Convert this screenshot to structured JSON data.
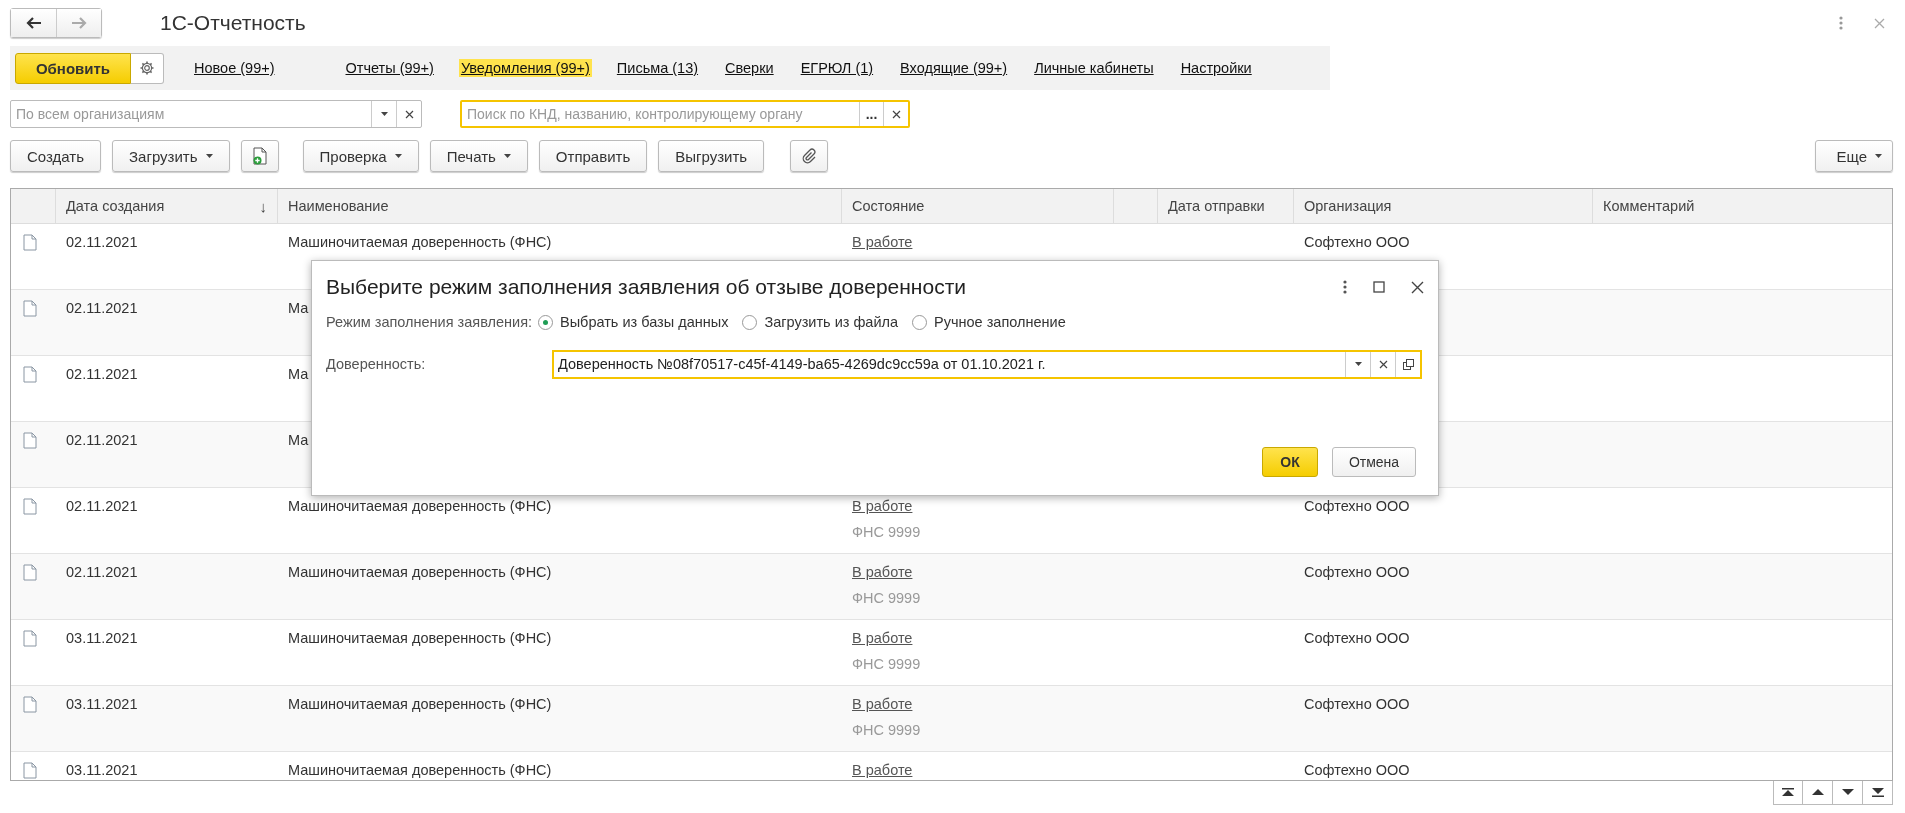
{
  "window": {
    "title": "1С-Отчетность"
  },
  "nav": {
    "refresh_button": "Обновить",
    "links": [
      {
        "label": "Новое (99+)",
        "selected": false
      },
      {
        "label": "Отчеты (99+)",
        "selected": false
      },
      {
        "label": "Уведомления (99+)",
        "selected": true
      },
      {
        "label": "Письма (13)",
        "selected": false
      },
      {
        "label": "Сверки",
        "selected": false
      },
      {
        "label": "ЕГРЮЛ (1)",
        "selected": false
      },
      {
        "label": "Входящие (99+)",
        "selected": false
      },
      {
        "label": "Личные кабинеты",
        "selected": false
      },
      {
        "label": "Настройки",
        "selected": false
      }
    ]
  },
  "filters": {
    "organization": {
      "placeholder": "По всем организациям"
    },
    "search": {
      "placeholder": "Поиск по КНД, названию, контролирующему органу",
      "more_button": "..."
    }
  },
  "toolbar": {
    "buttons": [
      {
        "label": "Создать",
        "kind": "plain"
      },
      {
        "label": "Загрузить",
        "kind": "menu"
      },
      {
        "kind": "add-document"
      },
      {
        "label": "Проверка",
        "kind": "menu"
      },
      {
        "label": "Печать",
        "kind": "menu"
      },
      {
        "label": "Отправить",
        "kind": "plain"
      },
      {
        "label": "Выгрузить",
        "kind": "plain"
      },
      {
        "kind": "attach"
      }
    ],
    "more_button": "Еще"
  },
  "table": {
    "columns": [
      "",
      "Дата создания",
      "Наименование",
      "Состояние",
      "",
      "Дата отправки",
      "Организация",
      "Комментарий"
    ],
    "sort_mark": "↓",
    "rows": [
      {
        "date": "02.11.2021",
        "name": "Машиночитаемая доверенность (ФНС)",
        "status": "В работе",
        "org": "Софтехно ООО"
      },
      {
        "date": "02.11.2021",
        "name": "Ма"
      },
      {
        "date": "02.11.2021",
        "name": "Ма"
      },
      {
        "date": "02.11.2021",
        "name": "Ма"
      },
      {
        "date": "02.11.2021",
        "name": "Машиночитаемая доверенность (ФНС)",
        "status": "В работе",
        "authority": "ФНС 9999",
        "org": "Софтехно ООО"
      },
      {
        "date": "02.11.2021",
        "name": "Машиночитаемая доверенность (ФНС)",
        "status": "В работе",
        "authority": "ФНС 9999",
        "org": "Софтехно ООО"
      },
      {
        "date": "03.11.2021",
        "name": "Машиночитаемая доверенность (ФНС)",
        "status": "В работе",
        "authority": "ФНС 9999",
        "org": "Софтехно ООО"
      },
      {
        "date": "03.11.2021",
        "name": "Машиночитаемая доверенность (ФНС)",
        "status": "В работе",
        "authority": "ФНС 9999",
        "org": "Софтехно ООО"
      },
      {
        "date": "03.11.2021",
        "name": "Машиночитаемая доверенность (ФНС)",
        "status": "В работе",
        "org": "Софтехно ООО"
      }
    ]
  },
  "dialog": {
    "title": "Выберите режим заполнения заявления об отзыве доверенности",
    "mode_label": "Режим заполнения заявления:",
    "modes": [
      {
        "label": "Выбрать из базы данных",
        "selected": true
      },
      {
        "label": "Загрузить из файла",
        "selected": false
      },
      {
        "label": "Ручное заполнение",
        "selected": false
      }
    ],
    "field_label": "Доверенность:",
    "field_value": "Доверенность №08f70517-c45f-4149-ba65-4269dc9cc59a от 01.10.2021 г.",
    "ok_button": "ОК",
    "cancel_button": "Отмена"
  }
}
